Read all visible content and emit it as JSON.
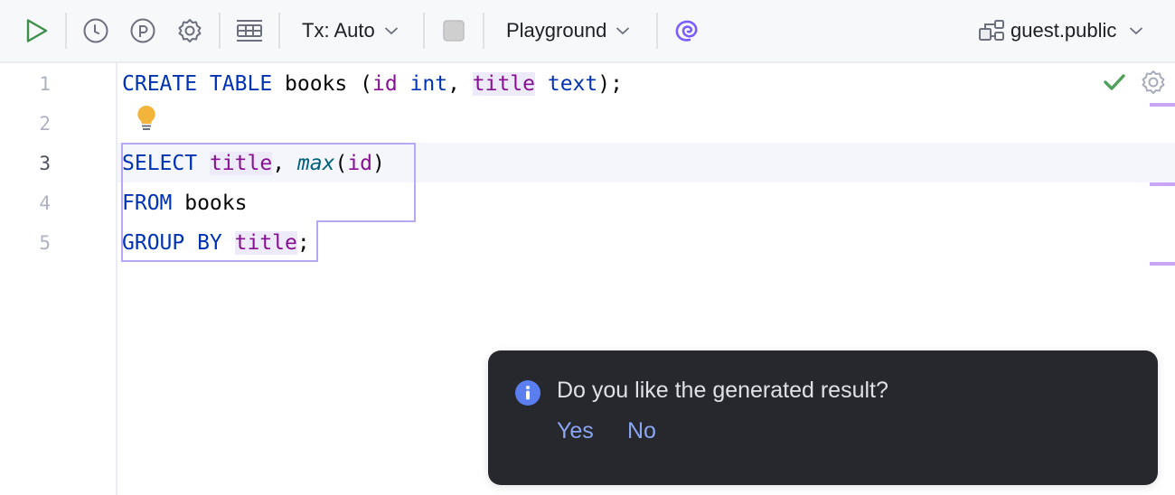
{
  "toolbar": {
    "run_icon": "play-icon",
    "history_icon": "clock-icon",
    "explain_icon": "p-circle-icon",
    "settings_icon": "gear-icon",
    "table_icon": "table-icon",
    "tx_mode_label": "Tx: Auto",
    "stop_icon": "stop-icon",
    "session_label": "Playground",
    "ai_icon": "ai-spiral-icon",
    "schema_icon": "schema-tree-icon",
    "schema_label": "guest.public"
  },
  "editor": {
    "line_numbers": [
      "1",
      "2",
      "3",
      "4",
      "5"
    ],
    "active_line": 3,
    "status_icon": "checkmark-icon",
    "status_settings_icon": "gear-icon",
    "intention_icon": "lightbulb-icon",
    "lines": {
      "l1": {
        "kw1": "CREATE TABLE",
        "name": " books ",
        "p1": "(",
        "c1": "id",
        "t1": " int",
        "p2": ", ",
        "c2": "title",
        "t2": " text",
        "p3": ");"
      },
      "l3": {
        "kw1": "SELECT",
        "sp": " ",
        "c1": "title",
        "p1": ", ",
        "fn": "max",
        "p2": "(",
        "c2": "id",
        "p3": ")"
      },
      "l4": {
        "kw1": "FROM",
        "name": " books"
      },
      "l5": {
        "kw1": "GROUP BY",
        "sp": " ",
        "c1": "title",
        "p1": ";"
      }
    }
  },
  "notification": {
    "icon": "info-icon",
    "message": "Do you like the generated result?",
    "yes_label": "Yes",
    "no_label": "No"
  },
  "colors": {
    "keyword": "#0033b3",
    "column": "#871094",
    "function": "#00627a",
    "accent_purple": "#7c5cff",
    "run_green": "#3f8f4c",
    "notification_bg": "#27282e",
    "link_blue": "#8aa5f2"
  }
}
